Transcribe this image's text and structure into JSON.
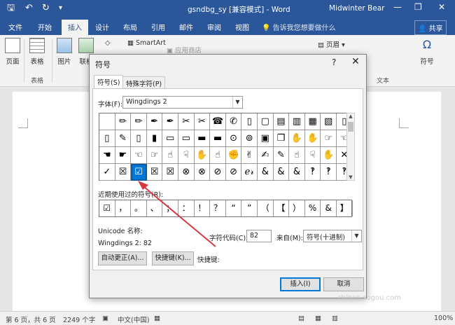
{
  "titlebar": {
    "title": "gsndbg_sy [兼容模式] - Word",
    "user": "Midwinter Bear",
    "save_icon": "save-icon",
    "undo_icon": "undo-icon",
    "redo_icon": "redo-icon",
    "minimize": "—",
    "restore": "❐",
    "close": "✕"
  },
  "ribbon_tabs": [
    "文件",
    "开始",
    "插入",
    "设计",
    "布局",
    "引用",
    "邮件",
    "审阅",
    "视图"
  ],
  "ribbon_active_tab": "插入",
  "tell_me": "告诉我您想要做什么",
  "share": "共享",
  "ribbon": {
    "buttons": [
      {
        "label": "页面",
        "icon": "page-icon"
      },
      {
        "label": "表格",
        "icon": "table-icon"
      },
      {
        "label": "图片",
        "icon": "picture-icon"
      },
      {
        "label": "联机",
        "icon": "online-picture-icon"
      }
    ],
    "smartart": "SmartArt",
    "app_store": "应用商店",
    "header_label": "页眉",
    "symbol_label": "符号",
    "group_table": "表格",
    "group_text": "文本"
  },
  "status": {
    "page": "第 6 页，共 6 页",
    "words": "2249 个字",
    "lang": "中文(中国)",
    "zoom": "100%"
  },
  "dialog": {
    "title": "符号",
    "help": "?",
    "close": "✕",
    "tabs": [
      "符号(S)",
      "特殊字符(P)"
    ],
    "font_label": "字体(F):",
    "font_value": "Wingdings 2",
    "symbols": [
      [
        "",
        "✏",
        "✏",
        "✒",
        "✒",
        "✂",
        "✂",
        "☎",
        "✆",
        "▯",
        "▢",
        "▤",
        "▥",
        "▦",
        "▧",
        "▯"
      ],
      [
        "▯",
        "✎",
        "▯",
        "▮",
        "▭",
        "▭",
        "▬",
        "▬",
        "⊙",
        "⊚",
        "▣",
        "❒",
        "✋",
        "✋",
        "☞",
        "☜"
      ],
      [
        "☚",
        "☛",
        "☜",
        "☞",
        "☝",
        "☟",
        "✋",
        "☝",
        "✊",
        "✌",
        "✍",
        "✎",
        "☝",
        "☟",
        "✋",
        "✕"
      ],
      [
        "✓",
        "☒",
        "☑",
        "☒",
        "☒",
        "⊗",
        "⊗",
        "⊘",
        "⊘",
        "ℯ𝓇",
        "&",
        "&",
        "&",
        "‽",
        "‽",
        "‽"
      ]
    ],
    "selected_row": 3,
    "selected_col": 2,
    "recent_label": "近期使用过的符号(R):",
    "recent": [
      "☑",
      "，",
      "。",
      "、",
      "；",
      "：",
      "！",
      "？",
      "“",
      "”",
      "（",
      "【",
      "）",
      "%",
      "&",
      "】"
    ],
    "unicode_label": "Unicode 名称:",
    "font_code": "Wingdings 2: 82",
    "char_code_label": "字符代码(C):",
    "char_code": "82",
    "from_label": "来自(M):",
    "from_value": "符号(十进制)",
    "autocorrect": "自动更正(A)...",
    "shortcut_key": "快捷键(K)...",
    "shortcut_label": "快捷键:",
    "insert": "插入(I)",
    "cancel": "取消"
  },
  "watermark": "搜狗指南",
  "watermark_url": "zhinan.sogou.com",
  "colors": {
    "word_blue": "#2b579a",
    "selected": "#0078d7",
    "arrow": "#d9363e"
  }
}
